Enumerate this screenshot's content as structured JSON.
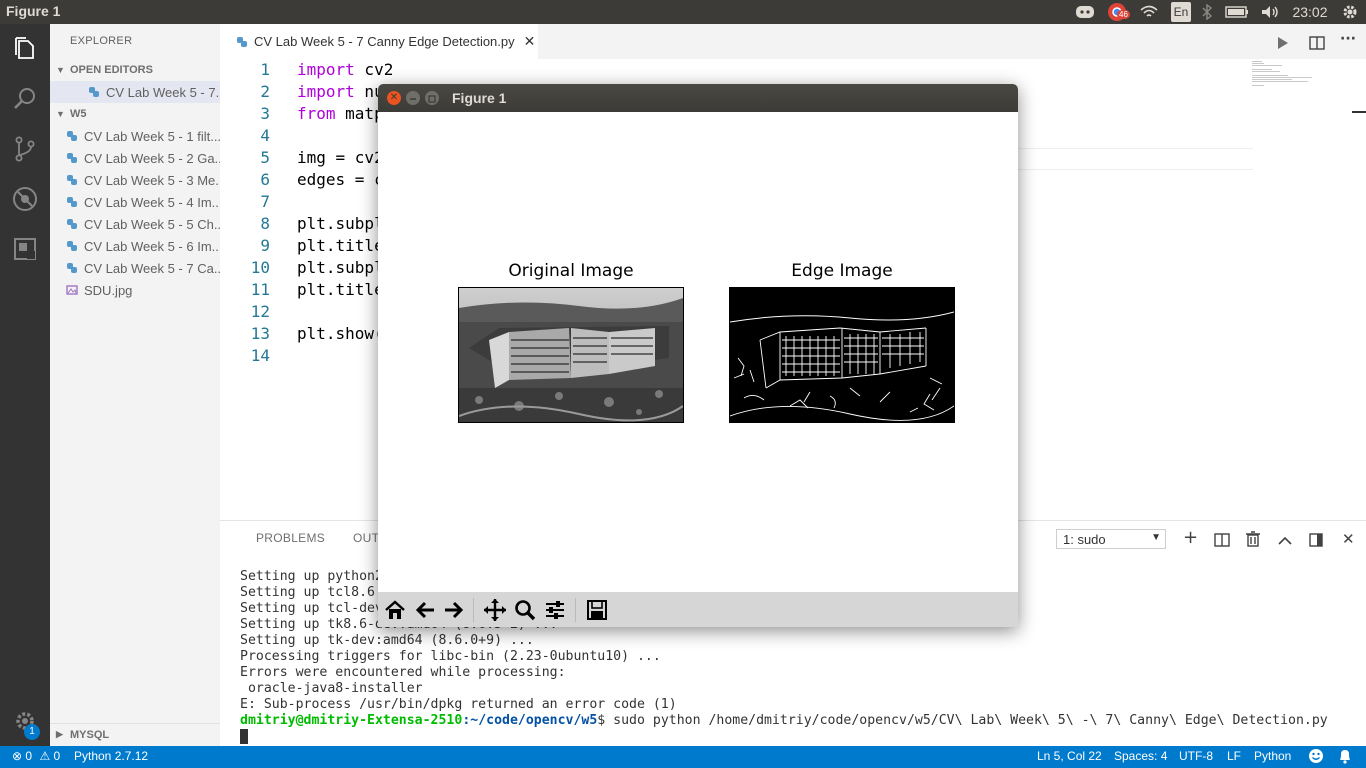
{
  "topbar": {
    "app_title": "Figure 1",
    "keyboard_layout": "En",
    "clock": "23:02",
    "notif_badge": "46"
  },
  "sidebar": {
    "title": "EXPLORER",
    "open_editors_label": "OPEN EDITORS",
    "open_editors": [
      {
        "label": "CV Lab Week 5 - 7..."
      }
    ],
    "folder_label": "W5",
    "files": [
      {
        "label": "CV Lab Week 5 - 1 filt..."
      },
      {
        "label": "CV Lab Week 5 - 2 Ga..."
      },
      {
        "label": "CV Lab Week 5 - 3 Me..."
      },
      {
        "label": "CV Lab Week 5 - 4 Im..."
      },
      {
        "label": "CV Lab Week 5 - 5 Ch..."
      },
      {
        "label": "CV Lab Week 5 - 6 Im..."
      },
      {
        "label": "CV Lab Week 5 - 7 Ca..."
      },
      {
        "label": "SDU.jpg"
      }
    ],
    "mysql_label": "MYSQL",
    "settings_badge": "1"
  },
  "editor": {
    "tab_label": "CV Lab Week 5 - 7 Canny Edge Detection.py",
    "lines": [
      {
        "num": "1",
        "kw": "import",
        "text": " cv2"
      },
      {
        "num": "2",
        "kw": "import",
        "text": " nu"
      },
      {
        "num": "3",
        "kw": "from",
        "text": " matp"
      },
      {
        "num": "4",
        "kw": "",
        "text": ""
      },
      {
        "num": "5",
        "kw": "",
        "text": "img = cv2"
      },
      {
        "num": "6",
        "kw": "",
        "text": "edges = c"
      },
      {
        "num": "7",
        "kw": "",
        "text": ""
      },
      {
        "num": "8",
        "kw": "",
        "text": "plt.subpl"
      },
      {
        "num": "9",
        "kw": "",
        "text": "plt.title"
      },
      {
        "num": "10",
        "kw": "",
        "text": "plt.subpl"
      },
      {
        "num": "11",
        "kw": "",
        "text": "plt.title"
      },
      {
        "num": "12",
        "kw": "",
        "text": ""
      },
      {
        "num": "13",
        "kw": "",
        "text": "plt.show("
      },
      {
        "num": "14",
        "kw": "",
        "text": ""
      }
    ]
  },
  "panel": {
    "tabs": [
      "PROBLEMS",
      "OUT"
    ],
    "terminal_select": "1: sudo",
    "terminal_lines": [
      "Setting up python2",
      "Setting up tcl8.6",
      "Setting up tcl-dev",
      "Setting up tk8.6-dev:amd64 (8.6.5-2) ...",
      "Setting up tk-dev:amd64 (8.6.0+9) ...",
      "Processing triggers for libc-bin (2.23-0ubuntu10) ...",
      "Errors were encountered while processing:",
      " oracle-java8-installer",
      "E: Sub-process /usr/bin/dpkg returned an error code (1)"
    ],
    "prompt_user": "dmitriy@dmitriy-Extensa-2510",
    "prompt_path": ":~/code/opencv/w5",
    "prompt_command": "$ sudo python /home/dmitriy/code/opencv/w5/CV\\ Lab\\ Week\\ 5\\ -\\ 7\\ Canny\\ Edge\\ Detection.py"
  },
  "status": {
    "errors": "0",
    "warnings": "0",
    "interpreter": "Python 2.7.12",
    "position": "Ln 5, Col 22",
    "spaces": "Spaces: 4",
    "encoding": "UTF-8",
    "eol": "LF",
    "language": "Python"
  },
  "figure": {
    "window_title": "Figure 1",
    "left_title": "Original Image",
    "right_title": "Edge Image"
  }
}
